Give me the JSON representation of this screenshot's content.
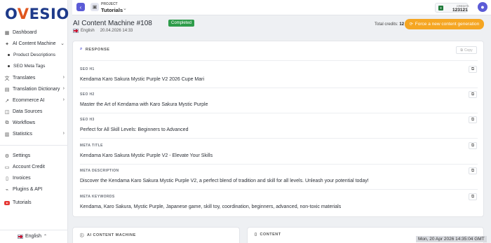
{
  "brand": {
    "logo_prefix": "O",
    "logo_mark": "V",
    "logo_suffix": "ESIO"
  },
  "sidebar": {
    "items": [
      {
        "label": "Dashboard",
        "icon": "grid-icon"
      },
      {
        "label": "AI Content Machine",
        "icon": "sparkle-icon",
        "expanded": true
      },
      {
        "label": "Product Descriptions",
        "sub": true
      },
      {
        "label": "SEO Meta Tags",
        "sub": true
      },
      {
        "label": "Translates",
        "icon": "translate-icon"
      },
      {
        "label": "Translation Dictionary",
        "icon": "book-icon"
      },
      {
        "label": "Ecommerce AI",
        "icon": "trend-icon"
      },
      {
        "label": "Data Sources",
        "icon": "database-icon"
      },
      {
        "label": "Workflows",
        "icon": "workflow-icon"
      },
      {
        "label": "Statistics",
        "icon": "chart-icon"
      },
      {
        "label": "Settings",
        "icon": "gear-icon"
      },
      {
        "label": "Account Credit",
        "icon": "card-icon"
      },
      {
        "label": "Invoices",
        "icon": "invoice-icon"
      },
      {
        "label": "Plugins & API",
        "icon": "plug-icon"
      },
      {
        "label": "Tutorials",
        "icon": "youtube-icon"
      }
    ],
    "language": "English"
  },
  "topbar": {
    "project_label": "PROJECT",
    "project_name": "Tutorials",
    "credits_label": "CREDITS",
    "credits_value": "123121"
  },
  "page": {
    "title": "AI Content Machine #108",
    "status": "Completed",
    "status_color": "#2e9c4a",
    "language": "English",
    "date": "20.04.2026 14:33",
    "total_credits_label": "Total credits:",
    "total_credits_value": "12",
    "force_button": "Force a new content generation",
    "accent": "#f5a623"
  },
  "response": {
    "heading": "RESPONSE",
    "copy_label": "Copy",
    "fields": [
      {
        "label": "SEO H1",
        "value": "Kendama Karo Sakura Mystic Purple V2 2026 Cupe Mari"
      },
      {
        "label": "SEO H2",
        "value": "Master the Art of Kendama with Karo Sakura Mystic Purple"
      },
      {
        "label": "SEO H3",
        "value": "Perfect for All Skill Levels: Beginners to Advanced"
      },
      {
        "label": "META TITLE",
        "value": "Kendama Karo Sakura Mystic Purple V2 - Elevate Your Skills"
      },
      {
        "label": "META DESCRIPTION",
        "value": "Discover the Kendama Karo Sakura Mystic Purple V2, a perfect blend of tradition and skill for all levels. Unleash your potential today!"
      },
      {
        "label": "META KEYWORDS",
        "value": "Kendama, Karo Sakura, Mystic Purple, Japanese game, skill toy, coordination, beginners, advanced, non-toxic materials"
      }
    ]
  },
  "panels": {
    "left": "AI CONTENT MACHINE",
    "right": "CONTENT"
  },
  "timestamp": "Mon, 20 Apr 2026 14:35:04 GMT"
}
